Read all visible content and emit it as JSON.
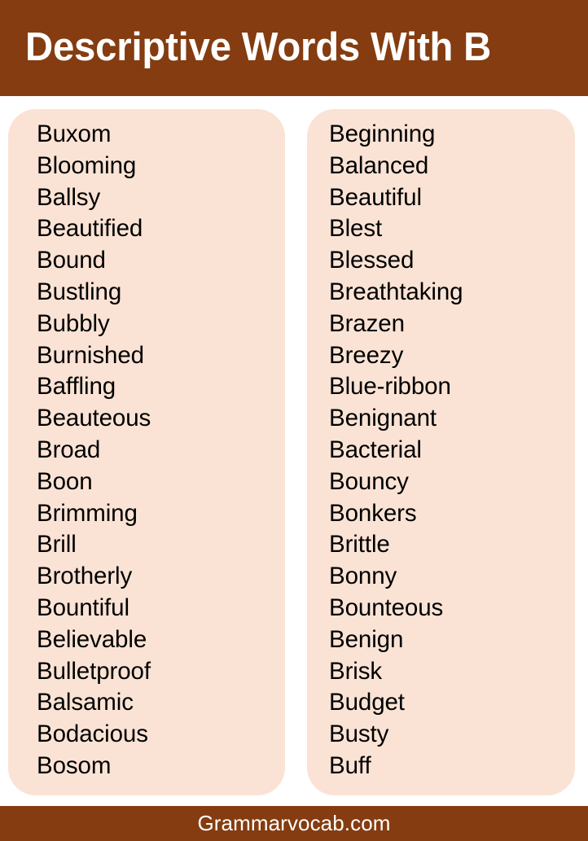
{
  "colors": {
    "brand_brown": "#843C10",
    "card_background": "#FAE3D5",
    "page_background": "#FFFFFF",
    "header_text": "#FFFFFF",
    "word_text": "#000000"
  },
  "header": {
    "title": "Descriptive Words With B"
  },
  "columns": [
    {
      "id": "left-column",
      "words": [
        "Buxom",
        "Blooming",
        "Ballsy",
        "Beautified",
        "Bound",
        "Bustling",
        "Bubbly",
        "Burnished",
        "Baffling",
        "Beauteous",
        "Broad",
        "Boon",
        "Brimming",
        "Brill",
        "Brotherly",
        "Bountiful",
        "Believable",
        "Bulletproof",
        "Balsamic",
        "Bodacious",
        "Bosom"
      ]
    },
    {
      "id": "right-column",
      "words": [
        "Beginning",
        "Balanced",
        "Beautiful",
        "Blest",
        "Blessed",
        "Breathtaking",
        "Brazen",
        "Breezy",
        "Blue-ribbon",
        "Benignant",
        "Bacterial",
        "Bouncy",
        "Bonkers",
        "Brittle",
        "Bonny",
        "Bounteous",
        "Benign",
        "Brisk",
        "Budget",
        "Busty",
        "Buff"
      ]
    }
  ],
  "footer": {
    "site": "Grammarvocab.com"
  }
}
